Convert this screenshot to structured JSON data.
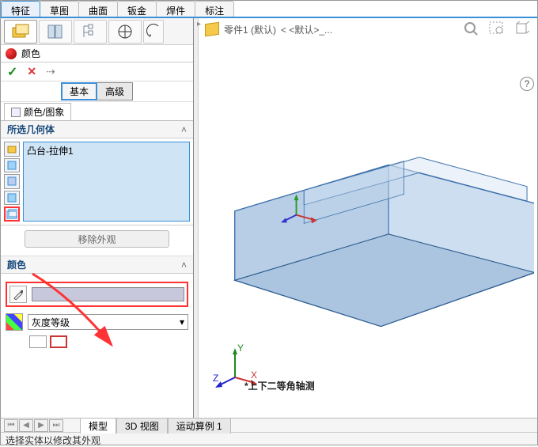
{
  "tabs": [
    "特征",
    "草图",
    "曲面",
    "钣金",
    "焊件",
    "标注"
  ],
  "panel": {
    "title": "颜色"
  },
  "confirm": {
    "ok": "✓",
    "cancel": "✕",
    "pin": "⇢"
  },
  "mode": {
    "basic": "基本",
    "advanced": "高级"
  },
  "subtab": {
    "label": "颜色/图象"
  },
  "sections": {
    "geom": "所选几何体",
    "color": "颜色"
  },
  "geom_item": "凸台-拉伸1",
  "remove_label": "移除外观",
  "preset": {
    "label": "灰度等级"
  },
  "breadcrumb": {
    "part": "零件1 (默认)",
    "state": "< <默认>_..."
  },
  "view_label": "*上下二等角轴测",
  "bottom_tabs": {
    "model": "模型",
    "view3d": "3D 视图",
    "motion": "运动算例 1"
  },
  "status": "选择实体以修改其外观",
  "triad": {
    "x": "X",
    "y": "Y",
    "z": "Z"
  },
  "caret": "˄",
  "dropdown_caret": "▾",
  "help": "?"
}
